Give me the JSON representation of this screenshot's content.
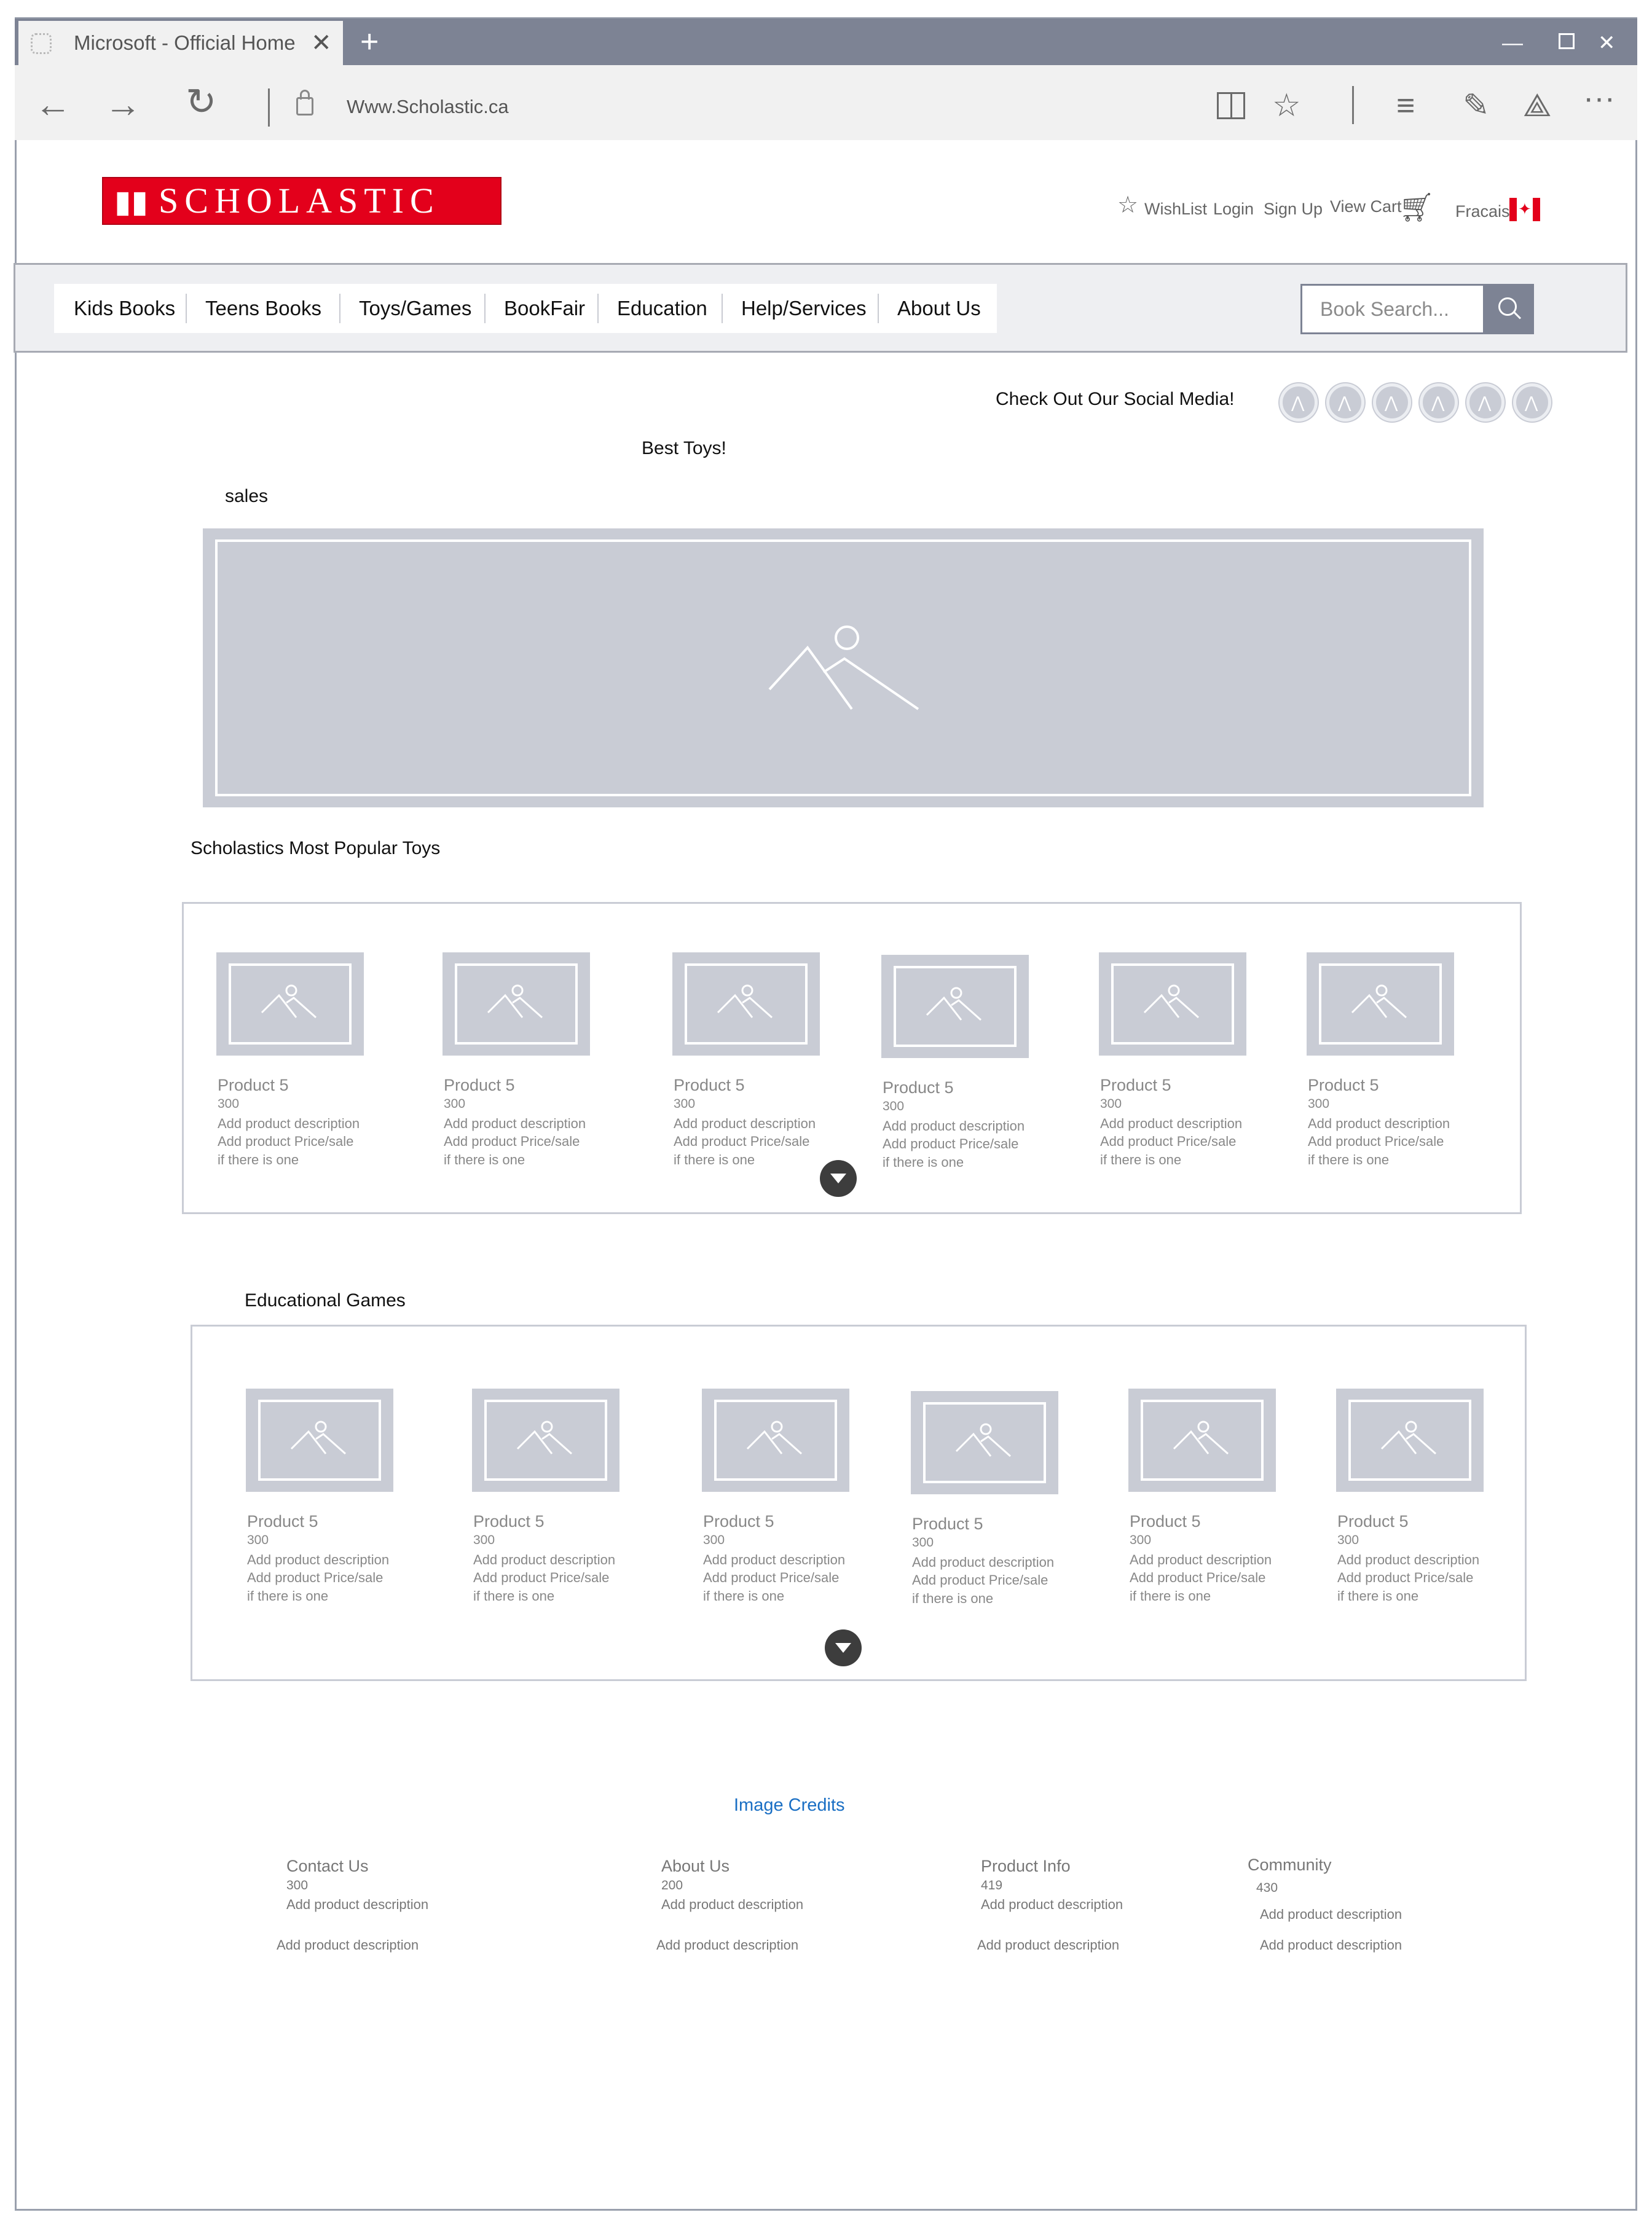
{
  "browser": {
    "tab_title": "Microsoft  - Official Home",
    "url": "Www.Scholastic.ca"
  },
  "header": {
    "logo_text": "SCHOLASTIC",
    "links": {
      "wishlist": "WishList",
      "login": "Login",
      "signup": "Sign Up",
      "viewcart": "View Cart",
      "language": "Fracais"
    }
  },
  "nav": {
    "items": [
      "Kids Books",
      "Teens Books",
      "Toys/Games",
      "BookFair",
      "Education",
      "Help/Services",
      "About Us"
    ],
    "search_placeholder": "Book Search..."
  },
  "social": {
    "label": "Check Out Our Social Media!",
    "count": 6
  },
  "sections": {
    "best_toys": "Best Toys!",
    "sales": "sales",
    "popular_title": "Scholastics Most Popular Toys",
    "games_title": "Educational Games"
  },
  "popular_products": [
    {
      "name": "Product 5",
      "number": "300",
      "line1": "Add product description",
      "line2": "Add product Price/sale",
      "line3": "if there is one"
    },
    {
      "name": "Product 5",
      "number": "300",
      "line1": "Add product description",
      "line2": "Add product Price/sale",
      "line3": "if there is one"
    },
    {
      "name": "Product 5",
      "number": "300",
      "line1": "Add product description",
      "line2": "Add product Price/sale",
      "line3": "if there is one"
    },
    {
      "name": "Product 5",
      "number": "300",
      "line1": "Add product description",
      "line2": "Add product Price/sale",
      "line3": "if there is one"
    },
    {
      "name": "Product 5",
      "number": "300",
      "line1": "Add product description",
      "line2": "Add product Price/sale",
      "line3": "if there is one"
    },
    {
      "name": "Product 5",
      "number": "300",
      "line1": "Add product description",
      "line2": "Add product Price/sale",
      "line3": "if there is one"
    }
  ],
  "games_products": [
    {
      "name": "Product 5",
      "number": "300",
      "line1": "Add product description",
      "line2": "Add product Price/sale",
      "line3": "if there is one"
    },
    {
      "name": "Product 5",
      "number": "300",
      "line1": "Add product description",
      "line2": "Add product Price/sale",
      "line3": "if there is one"
    },
    {
      "name": "Product 5",
      "number": "300",
      "line1": "Add product description",
      "line2": "Add product Price/sale",
      "line3": "if there is one"
    },
    {
      "name": "Product 5",
      "number": "300",
      "line1": "Add product description",
      "line2": "Add product Price/sale",
      "line3": "if there is one"
    },
    {
      "name": "Product 5",
      "number": "300",
      "line1": "Add product description",
      "line2": "Add product Price/sale",
      "line3": "if there is one"
    },
    {
      "name": "Product 5",
      "number": "300",
      "line1": "Add product description",
      "line2": "Add product Price/sale",
      "line3": "if there is one"
    }
  ],
  "footer": {
    "image_credits": "Image Credits",
    "columns": [
      {
        "title": "Contact Us",
        "number": "300",
        "desc1": "Add product description",
        "desc2": "Add product description"
      },
      {
        "title": "About Us",
        "number": "200",
        "desc1": "Add product description",
        "desc2": "Add product description"
      },
      {
        "title": "Product Info",
        "number": "419",
        "desc1": "Add product description",
        "desc2": "Add product description"
      },
      {
        "title": "Community",
        "number": "430",
        "desc1": "Add product description",
        "desc2": "Add product description"
      }
    ]
  },
  "colors": {
    "brand_red": "#e3001b",
    "placeholder_gray": "#c9ccd5",
    "chrome_gray": "#7d8394",
    "link_blue": "#1a6fc4"
  }
}
